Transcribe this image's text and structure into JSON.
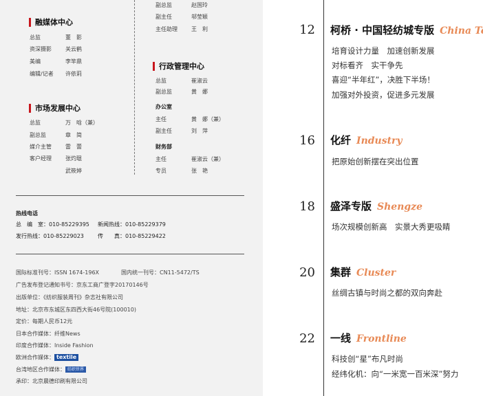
{
  "staff": {
    "top_right_rows": [
      {
        "role": "副总监",
        "name": "赵国玲"
      },
      {
        "role": "副主任",
        "name": "邬莹颖"
      },
      {
        "role": "主任助理",
        "name": "王　利"
      }
    ],
    "media_center": {
      "title": "融媒体中心",
      "rows": [
        {
          "role": "总监",
          "name": "董　影"
        },
        {
          "role": "资深摄影",
          "name": "关云鹤"
        },
        {
          "role": "美编",
          "name": "李竿鼎"
        },
        {
          "role": "编辑/记者",
          "name": "许依莉"
        }
      ]
    },
    "admin_center": {
      "title": "行政管理中心",
      "rows": [
        {
          "role": "总监",
          "name": "崔淑云"
        },
        {
          "role": "副总监",
          "name": "黄　娜"
        }
      ],
      "office": {
        "title": "办公室",
        "rows": [
          {
            "role": "主任",
            "name": "黄　娜（兼）"
          },
          {
            "role": "副主任",
            "name": "刘　萍"
          }
        ]
      },
      "finance": {
        "title": "财务部",
        "rows": [
          {
            "role": "主任",
            "name": "崔淑云（兼）"
          },
          {
            "role": "专员",
            "name": "张　艳"
          }
        ]
      }
    },
    "market_center": {
      "title": "市场发展中心",
      "rows": [
        {
          "role": "总监",
          "name": "万　晗（兼）"
        },
        {
          "role": "副总监",
          "name": "章　简"
        },
        {
          "role": "媒介主管",
          "name": "雷　蕾"
        },
        {
          "role": "客户经理",
          "name": "张灼琨"
        },
        {
          "role": "",
          "name": "武筱婷"
        }
      ]
    }
  },
  "hotline": {
    "title": "热线电话",
    "rows": [
      {
        "left_label": "总　编　室：",
        "left_value": "010-85229395",
        "right_label": "新闻热线：",
        "right_value": "010-85229379"
      },
      {
        "left_label": "发行热线：",
        "left_value": "010-85229023",
        "right_label": "传　　真：",
        "right_value": "010-85229422"
      }
    ]
  },
  "publication": {
    "issn_line": "国际标准刊号：ISSN 1674-196X",
    "cn_line": "国内统一刊号：CN11-5472/TS",
    "ad_license": "广告发布登记通知书号：京东工商广登字20170146号",
    "publisher": "出版单位：《纺织服装周刊》杂志社有限公司",
    "address": "地址：北京市东城区东四西大街46号院(100010)",
    "price": "定价：每期人民币12元",
    "japan_partner": "日本合作媒体：纤维News",
    "india_partner": "印度合作媒体：Inside Fashion",
    "europe_partner_label": "欧洲合作媒体：",
    "europe_partner_logo": "textile",
    "taiwan_partner_label": "台湾地区合作媒体：",
    "taiwan_partner_logo": "纺织世界",
    "printer": "承印：北京晨德印刷有限公司"
  },
  "toc": [
    {
      "page": "12",
      "title": "柯桥 · 中国轻纺城专版",
      "english": "China Te",
      "lines": [
        "培育设计力量　加速创新发展",
        "对标看齐　实干争先",
        "喜迎“半年红”，决胜下半场！",
        "加强对外投资，促进多元发展"
      ]
    },
    {
      "page": "16",
      "title": "化纤",
      "english": "Industry",
      "lines": [
        "把原始创新摆在突出位置"
      ]
    },
    {
      "page": "18",
      "title": "盛泽专版",
      "english": "Shengze",
      "lines": [
        "场次规模创新高　实景大秀更吸睛"
      ]
    },
    {
      "page": "20",
      "title": "集群",
      "english": "Cluster",
      "lines": [
        "丝绸古镇与时尚之都的双向奔赴"
      ]
    },
    {
      "page": "22",
      "title": "一线",
      "english": "Frontline",
      "lines": [
        "科技创“星”布凡时尚",
        "经纬化机：向“一米宽一百米深”努力"
      ]
    }
  ],
  "colors": {
    "accent": "#c8161d",
    "english_title": "#e88a56",
    "left_bg": "#f2f2f2"
  }
}
